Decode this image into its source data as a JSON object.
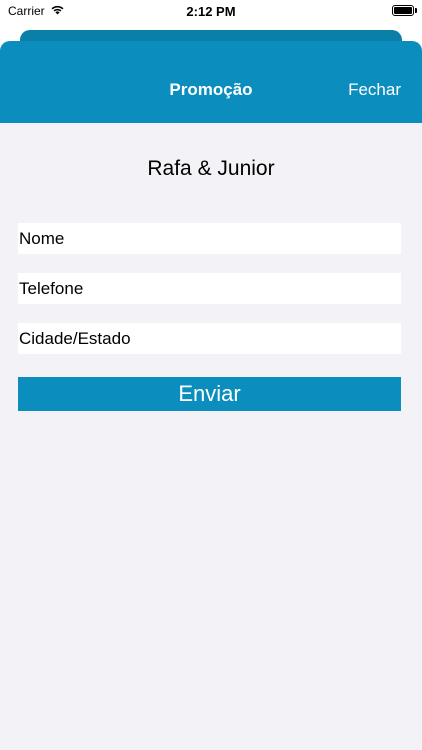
{
  "status_bar": {
    "carrier": "Carrier",
    "time": "2:12 PM",
    "battery_level": 1.0
  },
  "navbar": {
    "title": "Promoção",
    "close_label": "Fechar"
  },
  "main": {
    "artist_name": "Rafa & Junior",
    "fields": {
      "name_placeholder": "Nome",
      "phone_placeholder": "Telefone",
      "city_placeholder": "Cidade/Estado"
    },
    "submit_label": "Enviar"
  },
  "colors": {
    "accent": "#0b8dbe",
    "background": "#f2f2f7"
  }
}
